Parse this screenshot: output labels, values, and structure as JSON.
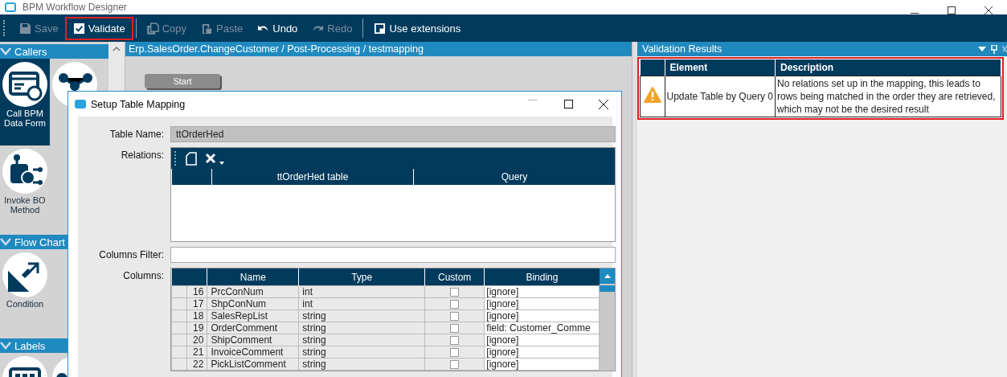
{
  "window": {
    "title": "BPM Workflow Designer"
  },
  "toolbar": [
    {
      "label": "Save",
      "kind": "save",
      "disabled": true,
      "highlighted": false,
      "divider_after": false
    },
    {
      "label": "Validate",
      "kind": "check",
      "disabled": false,
      "highlighted": true,
      "divider_after": true
    },
    {
      "label": "Copy",
      "kind": "copy",
      "disabled": true,
      "highlighted": false,
      "divider_after": false
    },
    {
      "label": "Paste",
      "kind": "paste",
      "disabled": true,
      "highlighted": false,
      "divider_after": false
    },
    {
      "label": "Undo",
      "kind": "undo",
      "disabled": false,
      "highlighted": false,
      "divider_after": false
    },
    {
      "label": "Redo",
      "kind": "redo",
      "disabled": true,
      "highlighted": false,
      "divider_after": true
    },
    {
      "label": "Use extensions",
      "kind": "ext",
      "disabled": false,
      "highlighted": false,
      "divider_after": false
    }
  ],
  "palette": [
    {
      "title": "Callers",
      "items": [
        {
          "label": "Call BPM Data Form",
          "kind": "form",
          "selected": true
        },
        {
          "kind": "nodes",
          "selected": false
        },
        {
          "label": "Invoke BO Method",
          "kind": "robot",
          "selected": false
        }
      ]
    },
    {
      "title": "Flow Chart",
      "items": [
        {
          "label": "Condition",
          "kind": "arrows",
          "selected": false
        }
      ]
    },
    {
      "title": "Labels",
      "items": [
        {
          "kind": "table",
          "selected": false
        },
        {
          "kind": "circle",
          "selected": false
        }
      ]
    }
  ],
  "canvas": {
    "breadcrumb": "Erp.SalesOrder.ChangeCustomer / Post-Processing / testmapping",
    "start_node": "Start"
  },
  "dialog": {
    "title": "Setup Table Mapping",
    "table_name_label": "Table Name:",
    "table_name": "ttOrderHed",
    "relations_label": "Relations:",
    "relations_columns": [
      "ttOrderHed table",
      "Query"
    ],
    "columns_filter_label": "Columns Filter:",
    "columns_label": "Columns:",
    "grid_columns": [
      "Name",
      "Type",
      "Custom",
      "Binding"
    ],
    "rows": [
      {
        "num": "16",
        "name": "PrcConNum",
        "type": "int",
        "custom": false,
        "binding": "[ignore]"
      },
      {
        "num": "17",
        "name": "ShpConNum",
        "type": "int",
        "custom": false,
        "binding": "[ignore]"
      },
      {
        "num": "18",
        "name": "SalesRepList",
        "type": "string",
        "custom": false,
        "binding": "[ignore]"
      },
      {
        "num": "19",
        "name": "OrderComment",
        "type": "string",
        "custom": false,
        "binding": "field: Customer_Comme"
      },
      {
        "num": "20",
        "name": "ShipComment",
        "type": "string",
        "custom": false,
        "binding": "[ignore]"
      },
      {
        "num": "21",
        "name": "InvoiceComment",
        "type": "string",
        "custom": false,
        "binding": "[ignore]"
      },
      {
        "num": "22",
        "name": "PickListComment",
        "type": "string",
        "custom": false,
        "binding": "[ignore]"
      }
    ]
  },
  "validation": {
    "title": "Validation Results",
    "highlighted": true,
    "columns": [
      "Element",
      "Description"
    ],
    "rows": [
      {
        "kind": "warning",
        "element": "Update Table by Query 0",
        "description": "No relations set up in the mapping, this leads to rows being matched in the order they are retrieved, which may not be the desired result"
      }
    ]
  }
}
